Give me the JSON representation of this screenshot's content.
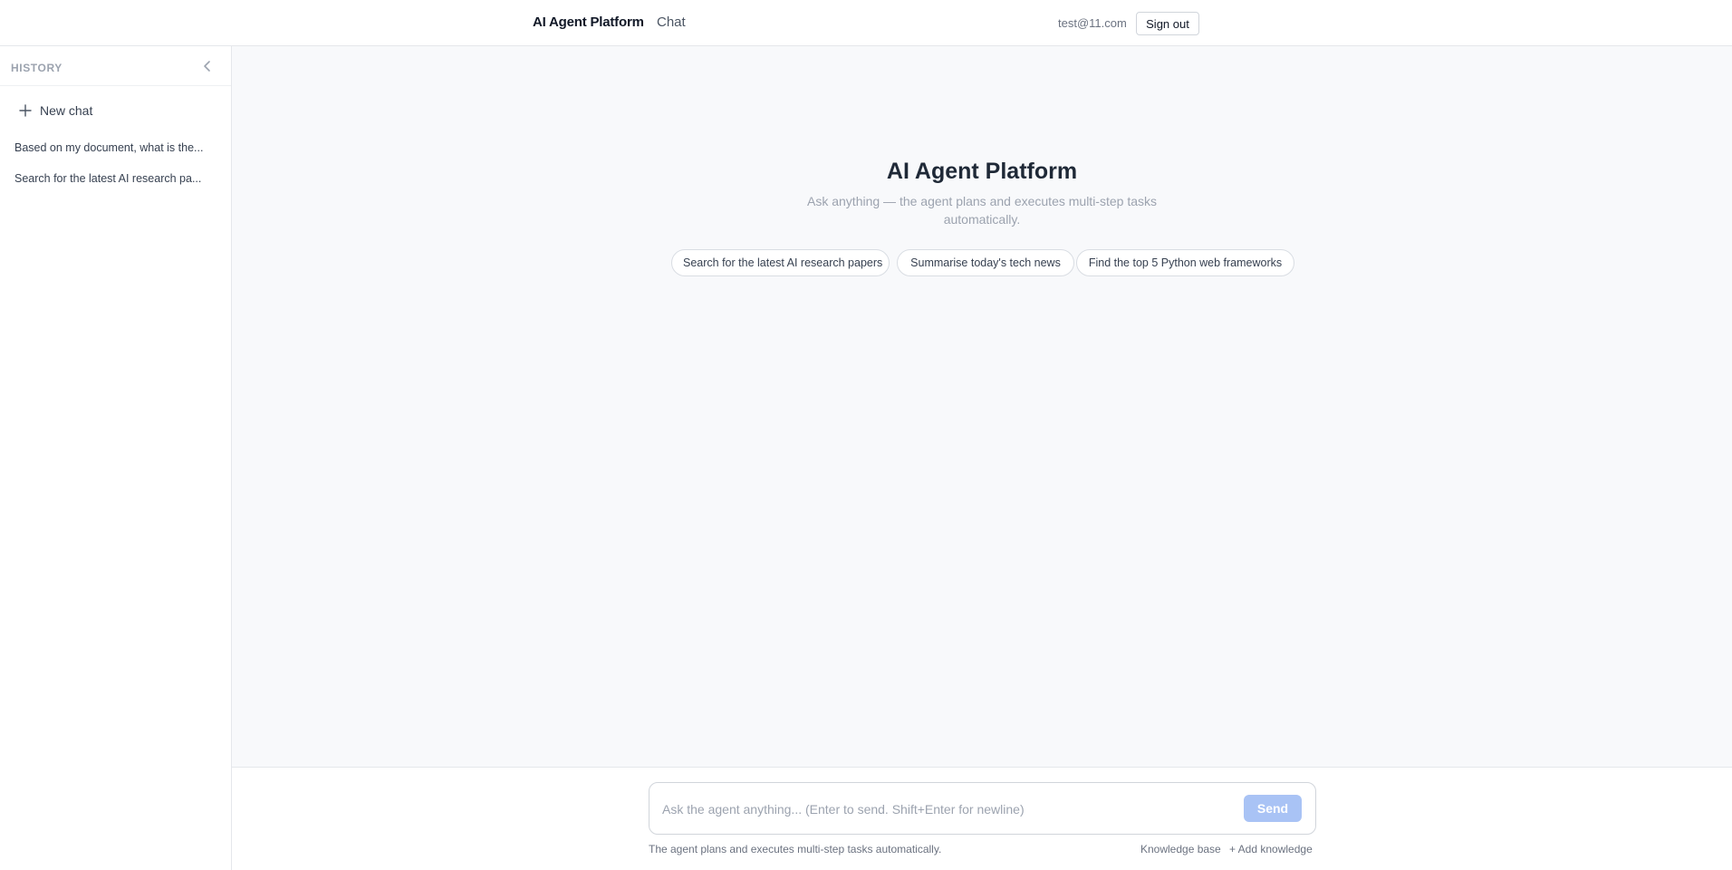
{
  "header": {
    "brand": "AI Agent Platform",
    "nav_chat": "Chat",
    "user_email": "test@11.com",
    "sign_out_label": "Sign out"
  },
  "sidebar": {
    "history_label": "HISTORY",
    "collapse_icon": "chevron-left-icon",
    "new_chat_icon": "plus-icon",
    "new_chat_label": "New chat",
    "items": [
      {
        "label": "Based on my document, what is the..."
      },
      {
        "label": "Search for the latest AI research pa..."
      }
    ]
  },
  "main": {
    "title": "AI Agent Platform",
    "subtitle": "Ask anything — the agent plans and executes multi-step tasks automatically.",
    "suggestions": [
      "Search for the latest AI research papers",
      "Summarise today's tech news",
      "Find the top 5 Python web frameworks"
    ]
  },
  "composer": {
    "placeholder": "Ask the agent anything... (Enter to send. Shift+Enter for newline)",
    "value": "",
    "send_label": "Send"
  },
  "footer": {
    "note": "The agent plans and executes multi-step tasks automatically.",
    "knowledge_base_label": "Knowledge base",
    "add_knowledge_label": "+ Add knowledge"
  },
  "colors": {
    "background_main": "#f8f9fb",
    "send_button": "#a9c3f5",
    "border": "#e5e7eb"
  }
}
